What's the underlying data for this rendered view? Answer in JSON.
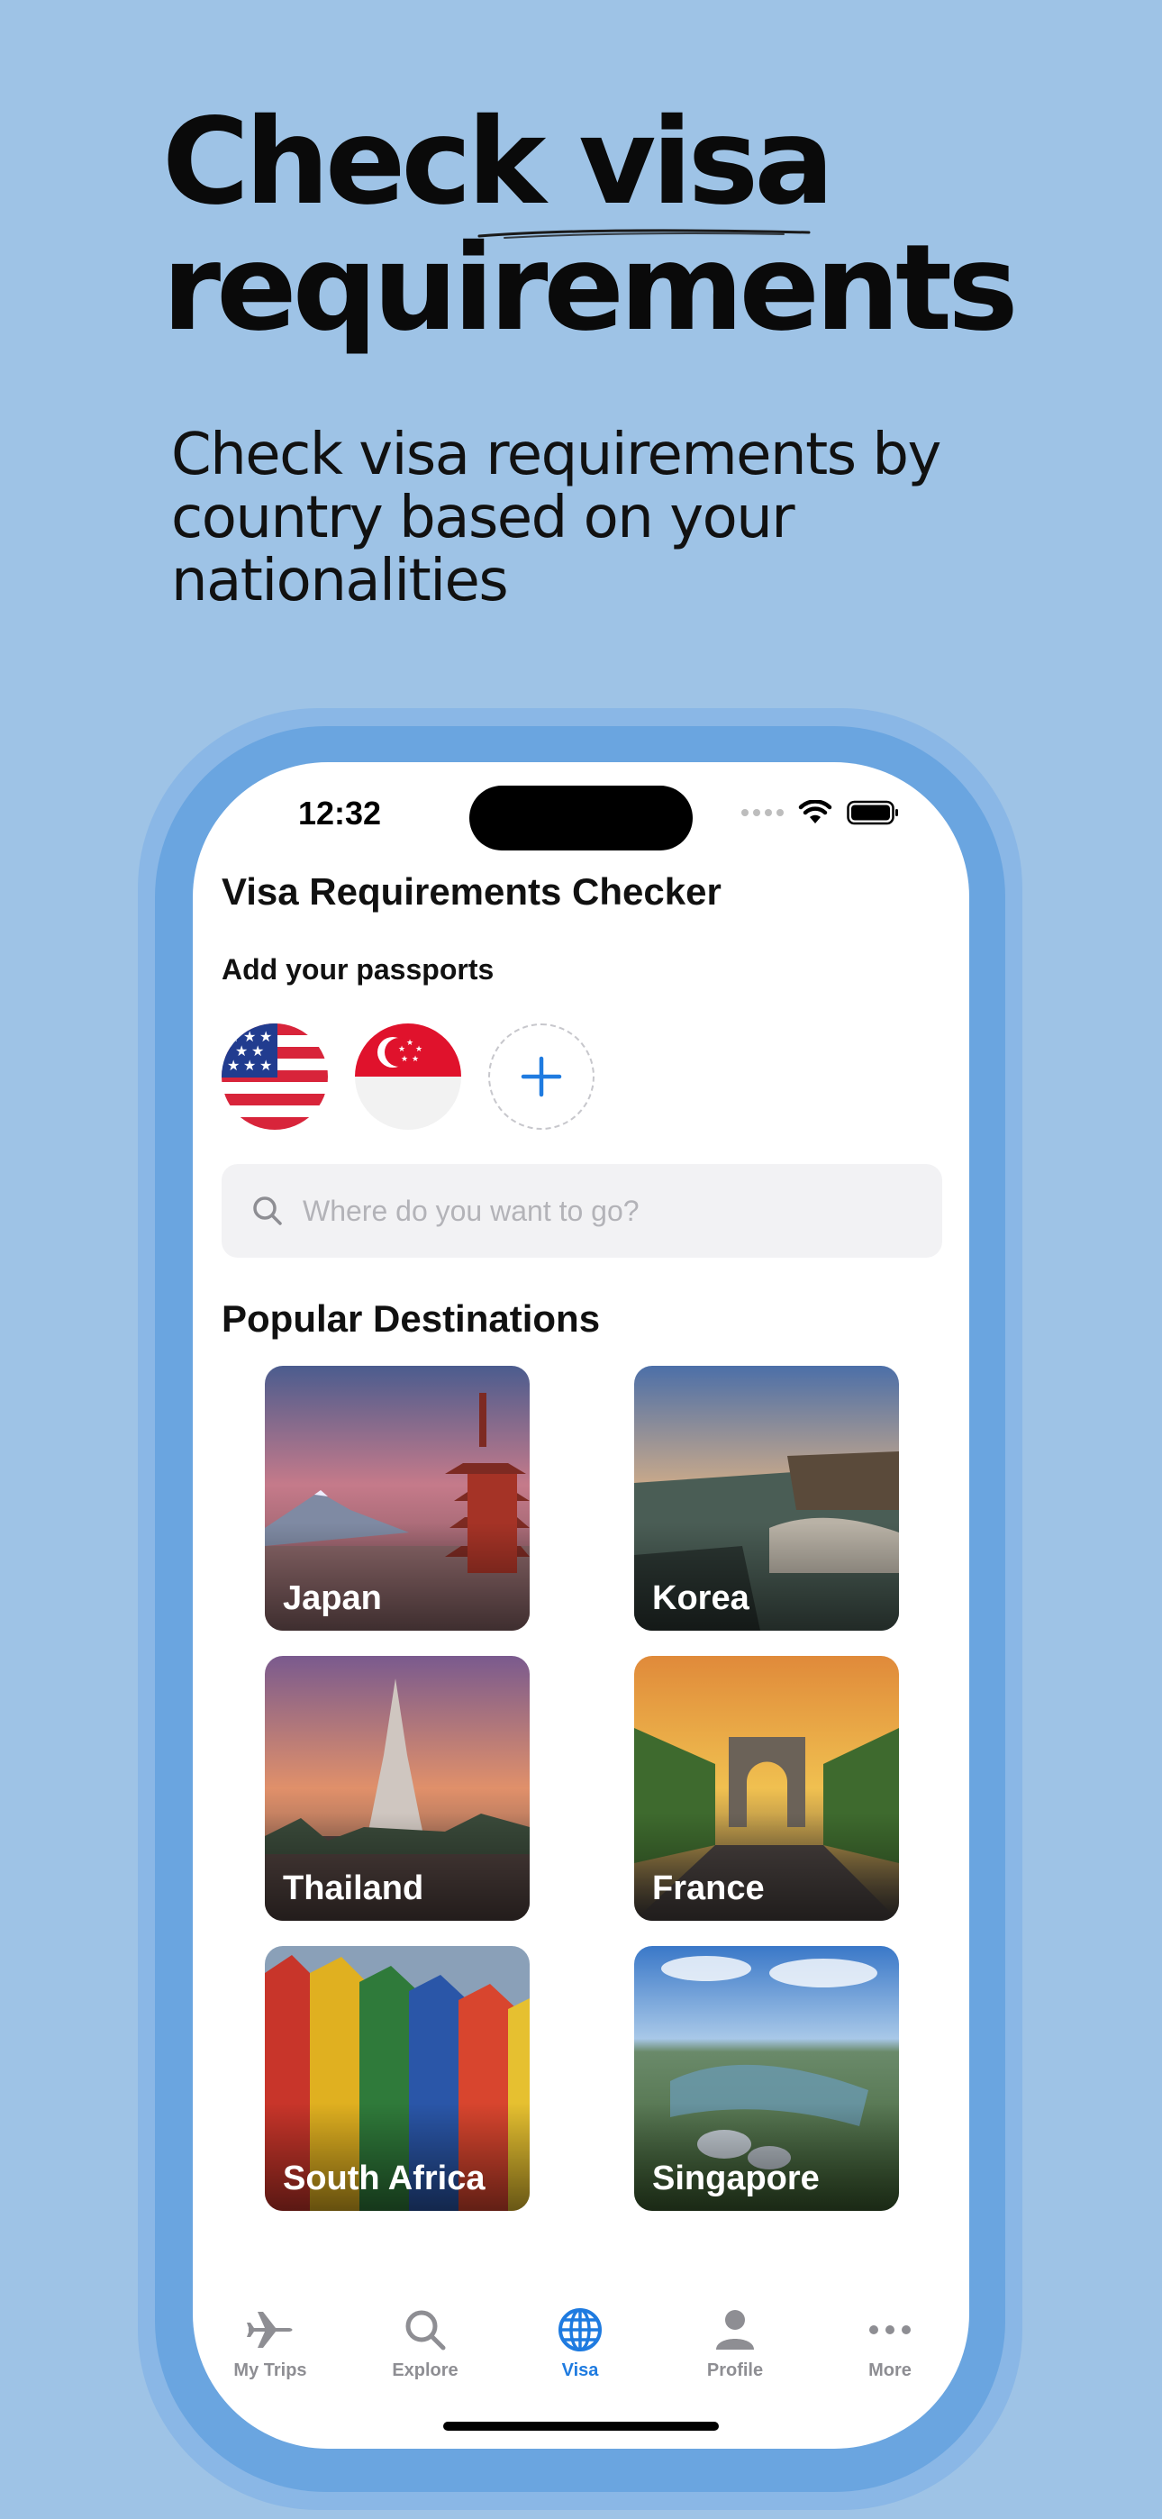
{
  "hero": {
    "title_line1": "Check visa",
    "title_line2": "requirements",
    "subtitle": "Check visa requirements by country based on your nationalities"
  },
  "status_bar": {
    "time": "12:32"
  },
  "app": {
    "title": "Visa Requirements Checker",
    "passports_label": "Add your passports",
    "passports": [
      {
        "country": "United States",
        "flag_icon": "us-flag-icon"
      },
      {
        "country": "Singapore",
        "flag_icon": "singapore-flag-icon"
      }
    ],
    "search": {
      "placeholder": "Where do you want to go?",
      "value": ""
    },
    "section_title": "Popular Destinations",
    "destinations": [
      {
        "name": "Japan"
      },
      {
        "name": "Korea"
      },
      {
        "name": "Thailand"
      },
      {
        "name": "France"
      },
      {
        "name": "South Africa"
      },
      {
        "name": "Singapore"
      }
    ]
  },
  "tabbar": {
    "items": [
      {
        "label": "My Trips",
        "icon": "airplane-icon"
      },
      {
        "label": "Explore",
        "icon": "search-icon"
      },
      {
        "label": "Visa",
        "icon": "globe-icon",
        "active": true
      },
      {
        "label": "Profile",
        "icon": "person-icon"
      },
      {
        "label": "More",
        "icon": "ellipsis-icon"
      }
    ]
  },
  "colors": {
    "background": "#9ec3e6",
    "phone_frame": "#6aa5e0",
    "accent": "#1f7be0",
    "inactive_tab": "#8e8e93"
  }
}
